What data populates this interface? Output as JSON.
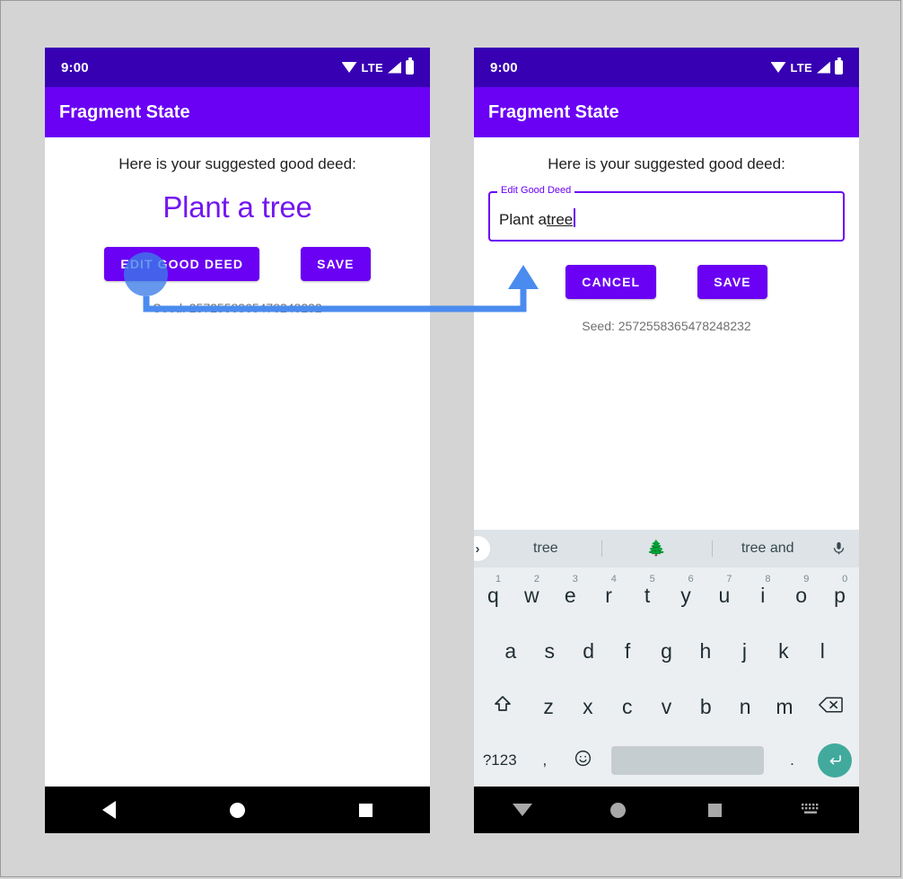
{
  "canvas": {
    "background": "#d4d4d4",
    "border_color": "#9a9a9a"
  },
  "colors": {
    "status_bar": "#3700b3",
    "app_bar": "#6a00f4",
    "primary": "#6a00f4",
    "headline": "#7317ef",
    "annotation": "#4a8bef",
    "enter_key": "#41aa9d",
    "keyboard_bg": "#eceff1",
    "suggest_bg": "#dde3e6"
  },
  "status_bar": {
    "clock": "9:00",
    "network_label": "LTE",
    "icons": [
      "wifi-icon",
      "signal-icon",
      "battery-icon"
    ]
  },
  "app_bar": {
    "title": "Fragment State"
  },
  "phone_left": {
    "subtitle": "Here is your suggested good deed:",
    "headline": "Plant a tree",
    "buttons": [
      {
        "name": "edit-good-deed-button",
        "label": "EDIT GOOD DEED"
      },
      {
        "name": "save-button",
        "label": "SAVE"
      }
    ],
    "seed": "Seed: 2572558365478248232",
    "nav": [
      {
        "name": "nav-back-button",
        "icon": "back-triangle-icon"
      },
      {
        "name": "nav-home-button",
        "icon": "home-circle-icon"
      },
      {
        "name": "nav-recents-button",
        "icon": "recents-square-icon"
      }
    ]
  },
  "phone_right": {
    "subtitle": "Here is your suggested good deed:",
    "field": {
      "label": "Edit Good Deed",
      "value_plain": "Plant a ",
      "value_composing": "tree",
      "full_value": "Plant a tree"
    },
    "buttons": [
      {
        "name": "cancel-button",
        "label": "CANCEL"
      },
      {
        "name": "save-button",
        "label": "SAVE"
      }
    ],
    "seed": "Seed: 2572558365478248232",
    "nav": [
      {
        "name": "nav-hide-keyboard-button",
        "icon": "down-triangle-icon"
      },
      {
        "name": "nav-home-button",
        "icon": "home-circle-icon"
      },
      {
        "name": "nav-recents-button",
        "icon": "recents-square-icon"
      },
      {
        "name": "nav-keyboard-switch-button",
        "icon": "keyboard-icon"
      }
    ]
  },
  "keyboard": {
    "suggestions": {
      "expand_icon": "chevron-right-icon",
      "items": [
        "tree",
        "🌲",
        "tree and"
      ],
      "mic_icon": "microphone-icon"
    },
    "row1": [
      {
        "key": "q",
        "hint": "1"
      },
      {
        "key": "w",
        "hint": "2"
      },
      {
        "key": "e",
        "hint": "3"
      },
      {
        "key": "r",
        "hint": "4"
      },
      {
        "key": "t",
        "hint": "5"
      },
      {
        "key": "y",
        "hint": "6"
      },
      {
        "key": "u",
        "hint": "7"
      },
      {
        "key": "i",
        "hint": "8"
      },
      {
        "key": "o",
        "hint": "9"
      },
      {
        "key": "p",
        "hint": "0"
      }
    ],
    "row2": [
      "a",
      "s",
      "d",
      "f",
      "g",
      "h",
      "j",
      "k",
      "l"
    ],
    "row3": {
      "shift_icon": "shift-icon",
      "keys": [
        "z",
        "x",
        "c",
        "v",
        "b",
        "n",
        "m"
      ],
      "backspace_icon": "backspace-icon"
    },
    "row4": {
      "symbols_label": "?123",
      "comma": ",",
      "emoji_icon": "emoji-smiley-icon",
      "space_label": "",
      "period": ".",
      "enter_icon": "enter-return-icon"
    }
  },
  "annotation": {
    "tap_target": "edit-good-deed-button",
    "arrow_points_to": "edit-good-deed-text-field",
    "color": "#4a8bef"
  }
}
